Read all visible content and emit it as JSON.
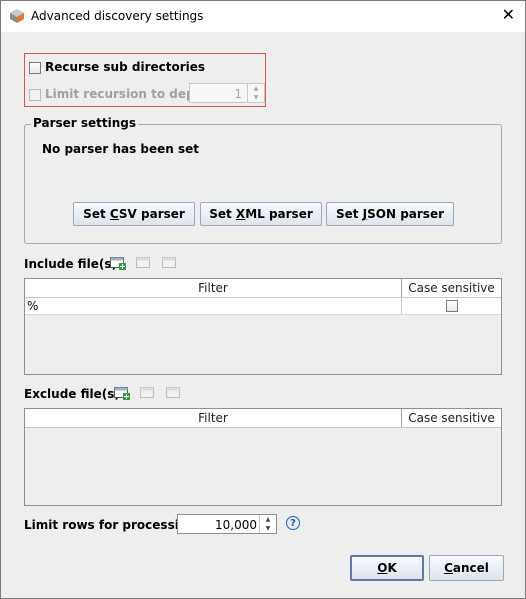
{
  "window": {
    "title": "Advanced discovery settings",
    "close_glyph": "✕",
    "app_icon": "db-logo-icon"
  },
  "recursion": {
    "recurse_label": "Recurse sub directories",
    "recurse_checked": false,
    "limit_label": "Limit recursion to depth",
    "limit_checked": false,
    "limit_enabled": false,
    "depth_value": "1"
  },
  "parser": {
    "legend": "Parser settings",
    "status": "No parser has been set",
    "buttons": [
      {
        "prefix": "Set ",
        "mnemonic": "C",
        "suffix": "SV parser"
      },
      {
        "prefix": "Set ",
        "mnemonic": "X",
        "suffix": "ML parser"
      },
      {
        "prefix": "Set ",
        "mnemonic": "J",
        "suffix": "SON parser"
      }
    ]
  },
  "include": {
    "label": "Include file(s):",
    "columns": [
      "Filter",
      "Case sensitive"
    ],
    "rows": [
      {
        "filter": "%",
        "case_sensitive": false
      }
    ],
    "toolbar_icons": [
      "add-filter-icon",
      "edit-filter-icon",
      "remove-filter-icon"
    ]
  },
  "exclude": {
    "label": "Exclude file(s):",
    "columns": [
      "Filter",
      "Case sensitive"
    ],
    "rows": [],
    "toolbar_icons": [
      "add-filter-icon",
      "edit-filter-icon",
      "remove-filter-icon"
    ]
  },
  "limit_rows": {
    "label": "Limit rows for processing:",
    "value": "10,000",
    "help_glyph": "?"
  },
  "footer": {
    "ok": {
      "mnemonic": "O",
      "suffix": "K"
    },
    "cancel": {
      "mnemonic": "C",
      "suffix": "ancel"
    }
  },
  "colors": {
    "highlight_border": "#d9534f",
    "dialog_bg": "#eeeeee",
    "help_blue": "#2a5db0"
  }
}
